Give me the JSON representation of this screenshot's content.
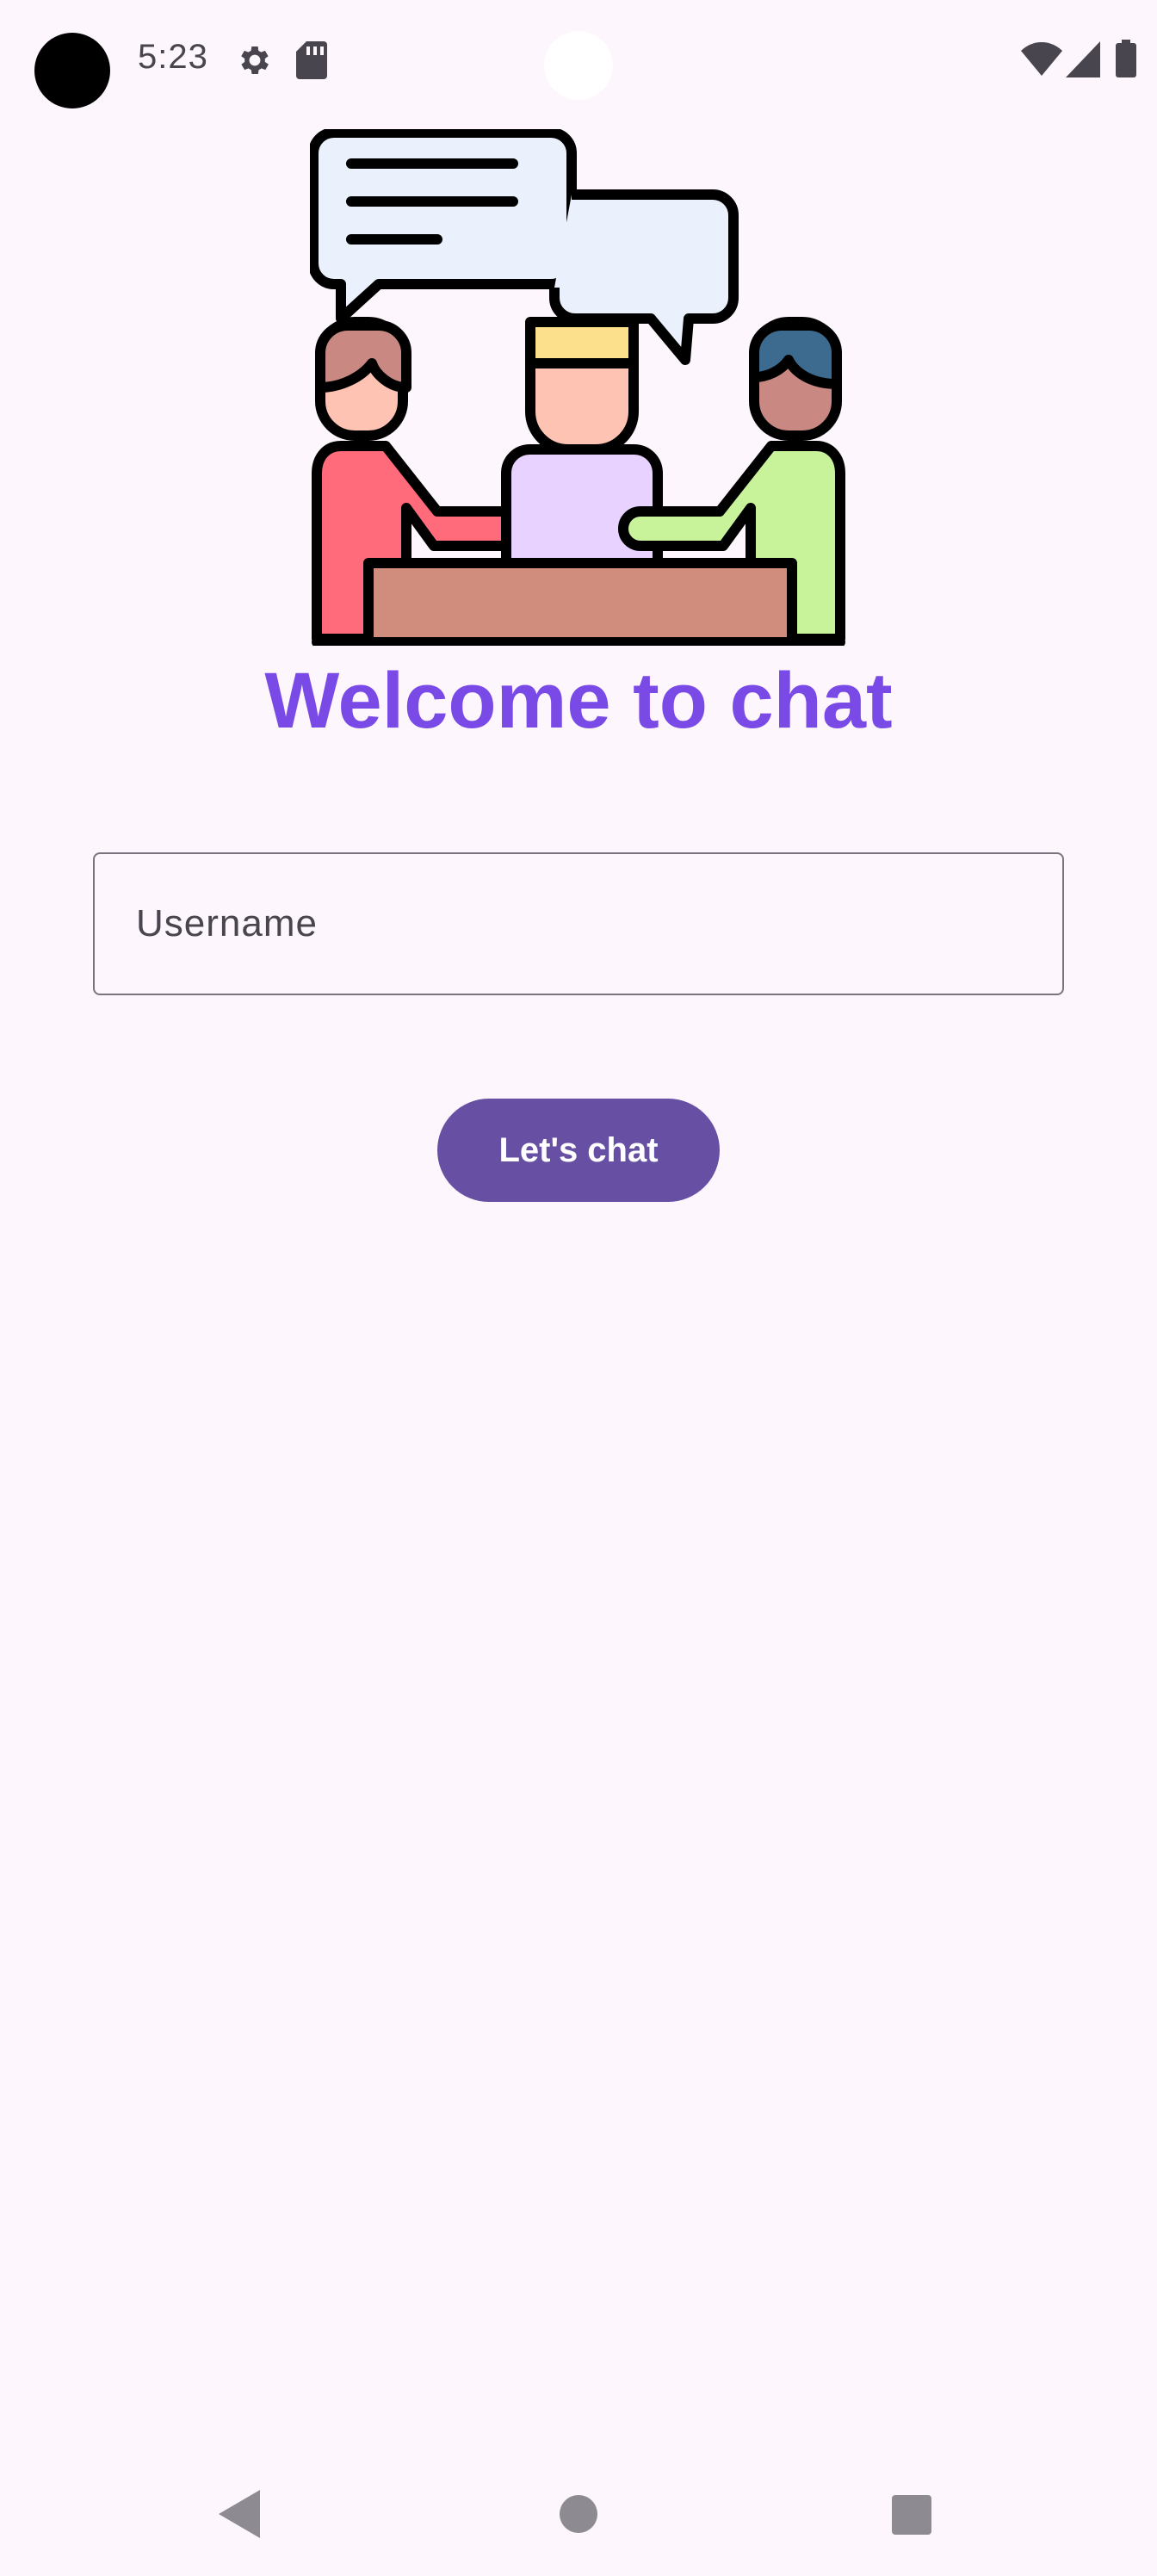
{
  "status_bar": {
    "time": "5:23",
    "icons": [
      "gear-icon",
      "sd-card-icon",
      "wifi-icon",
      "signal-icon",
      "battery-icon"
    ]
  },
  "illustration": {
    "name": "people-chatting-at-table-illustration"
  },
  "welcome": {
    "title": "Welcome to chat"
  },
  "username": {
    "placeholder": "Username",
    "value": ""
  },
  "actions": {
    "chat_button_label": "Let's chat"
  },
  "navigation": {
    "icons": [
      "back-icon",
      "home-icon",
      "recents-icon"
    ]
  },
  "colors": {
    "background": "#FDF6FC",
    "title": "#7A4AE6",
    "button": "#6750A4",
    "button_text": "#FFFFFF",
    "field_border": "#79747E"
  }
}
